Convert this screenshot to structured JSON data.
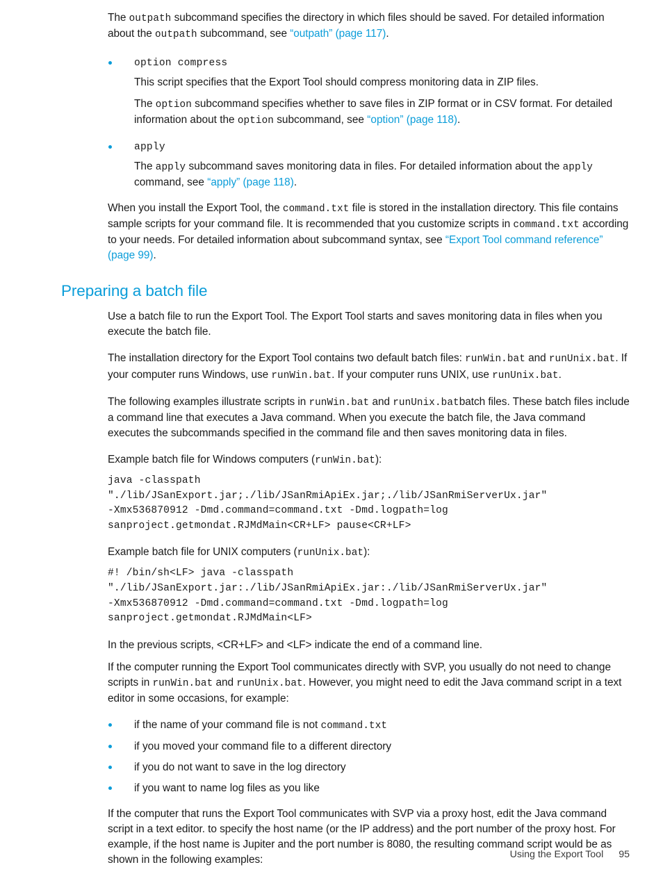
{
  "page": {
    "footer_title": "Using the Export Tool",
    "footer_page_number": "95",
    "accent_color": "#0b9dd9",
    "text_color": "#1a1a1a"
  },
  "outpath_para": {
    "t1": "The ",
    "c1": "outpath",
    "t2": " subcommand specifies the directory in which files should be saved. For detailed information about the ",
    "c2": "outpath",
    "t3": " subcommand, see ",
    "link": "“outpath” (page 117)",
    "t4": "."
  },
  "bullets": [
    {
      "label": "option compress",
      "paras": [
        {
          "t1": "This script specifies that the Export Tool should compress monitoring data in ZIP files."
        },
        {
          "t1": "The ",
          "c1": "option",
          "t2": " subcommand specifies whether to save files in ZIP format or in CSV format. For detailed information about the ",
          "c2": "option",
          "t3": " subcommand, see ",
          "link": "“option” (page 118)",
          "t4": "."
        }
      ]
    },
    {
      "label": "apply",
      "paras": [
        {
          "t1": "The ",
          "c1": "apply",
          "t2": " subcommand saves monitoring data in files. For detailed information about the ",
          "c2": "apply",
          "t3": " command, see ",
          "link": "“apply” (page 118)",
          "t4": "."
        }
      ]
    }
  ],
  "install_para": {
    "t1": "When you install the Export Tool, the ",
    "c1": "command.txt",
    "t2": " file is stored in the installation directory. This file contains sample scripts for your command file. It is recommended that you customize scripts in ",
    "c2": "command.txt",
    "t3": " according to your needs. For detailed information about subcommand syntax, see ",
    "link": "“Export Tool command reference” (page 99)",
    "t4": "."
  },
  "section": {
    "heading": "Preparing a batch file",
    "intro": "Use a batch file to run the Export Tool. The Export Tool starts and saves monitoring data in files when you execute the batch file.",
    "install_dir": {
      "t1": "The installation directory for the Export Tool contains two default batch files: ",
      "c1": "runWin.bat",
      "t2": " and ",
      "c2": "runUnix.bat",
      "t3": ". If your computer runs Windows, use ",
      "c3": "runWin.bat",
      "t4": ". If your computer runs UNIX, use ",
      "c4": "runUnix.bat",
      "t5": "."
    },
    "examples_intro": {
      "t1": "The following examples illustrate scripts in ",
      "c1": "runWin.bat",
      "t2": " and ",
      "c2": "runUnix.bat",
      "t3": "batch files. These batch files include a command line that executes a Java command. When you execute the batch file, the Java command executes the subcommands specified in the command file and then saves monitoring data in files."
    },
    "windows_caption": {
      "t1": "Example batch file for Windows computers (",
      "c1": "runWin.bat",
      "t2": "):"
    },
    "windows_code": "java -classpath\n\"./lib/JSanExport.jar;./lib/JSanRmiApiEx.jar;./lib/JSanRmiServerUx.jar\"\n-Xmx536870912 -Dmd.command=command.txt -Dmd.logpath=log\nsanproject.getmondat.RJMdMain<CR+LF> pause<CR+LF>",
    "unix_caption": {
      "t1": "Example batch file for UNIX computers (",
      "c1": "runUnix.bat",
      "t2": "):"
    },
    "unix_code": "#! /bin/sh<LF> java -classpath\n\"./lib/JSanExport.jar:./lib/JSanRmiApiEx.jar:./lib/JSanRmiServerUx.jar\"\n-Xmx536870912 -Dmd.command=command.txt -Dmd.logpath=log\nsanproject.getmondat.RJMdMain<LF>",
    "line_end_note": "In the previous scripts, <CR+LF> and <LF> indicate the end of a command line.",
    "svp_para": {
      "t1": "If the computer running the Export Tool communicates directly with SVP, you usually do not need to change scripts in ",
      "c1": "runWin.bat",
      "t2": " and ",
      "c2": "runUnix.bat",
      "t3": ". However, you might need to edit the Java command script in a text editor in some occasions, for example:"
    },
    "edit_reasons": [
      {
        "t1": "if the name of your command file is not ",
        "c1": "command.txt",
        "t2": ""
      },
      {
        "t1": "if you moved your command file to a different directory",
        "c1": "",
        "t2": ""
      },
      {
        "t1": "if you do not want to save in the log directory",
        "c1": "",
        "t2": ""
      },
      {
        "t1": "if you want to name log files as you like",
        "c1": "",
        "t2": ""
      }
    ],
    "proxy_para": "If the computer that runs the Export Tool communicates with SVP via a proxy host, edit the Java command script in a text editor. to specify the host name (or the IP address) and the port number of the proxy host. For example, if the host name is Jupiter and the port number is 8080, the resulting command script would be as shown in the following examples:"
  }
}
